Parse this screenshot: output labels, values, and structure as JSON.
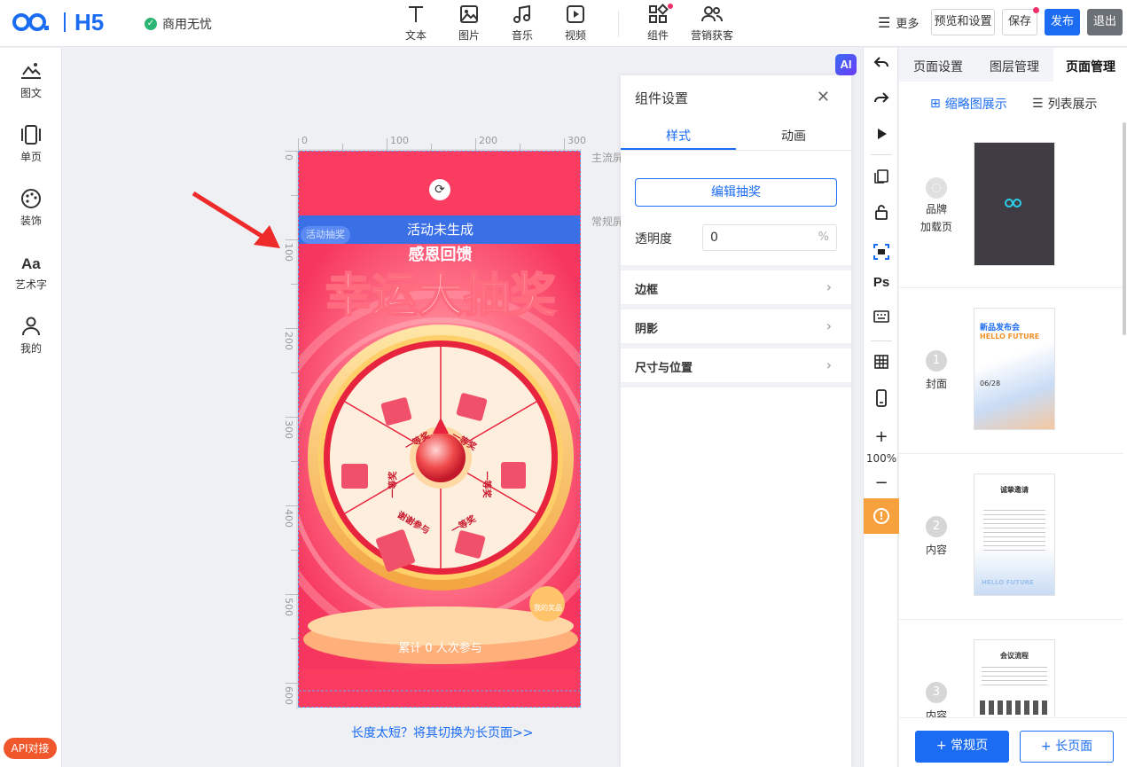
{
  "app": {
    "brand": "H5",
    "commerce_badge": "商用无忧"
  },
  "toolbar": {
    "items": [
      {
        "label": "文本",
        "icon": "text-icon"
      },
      {
        "label": "图片",
        "icon": "image-icon"
      },
      {
        "label": "音乐",
        "icon": "music-icon"
      },
      {
        "label": "视频",
        "icon": "video-icon"
      },
      {
        "label": "组件",
        "icon": "components-icon"
      },
      {
        "label": "营销获客",
        "icon": "users-icon"
      }
    ],
    "more": "更多",
    "preview": "预览和设置",
    "save": "保存",
    "publish": "发布",
    "exit": "退出"
  },
  "sidebar": {
    "items": [
      {
        "label": "图文",
        "icon": "image-text-icon"
      },
      {
        "label": "单页",
        "icon": "single-page-icon"
      },
      {
        "label": "装饰",
        "icon": "palette-icon"
      },
      {
        "label": "艺术字",
        "icon": "art-text-icon"
      },
      {
        "label": "我的",
        "icon": "user-icon"
      }
    ],
    "api_button": "API对接"
  },
  "canvas": {
    "ruler_top": [
      "0",
      "100",
      "200",
      "300"
    ],
    "ruler_left": [
      "0",
      "100",
      "200",
      "300",
      "400",
      "500",
      "600"
    ],
    "guide_main": "主流屏",
    "guide_normal": "常规屏",
    "banner_status": "活动未生成",
    "tag": "活动抽奖",
    "subtitle": "感恩回馈",
    "title": "幸运大抽奖",
    "prize_labels": [
      "一等奖",
      "一等奖",
      "一等奖",
      "谢谢参与",
      "一等奖",
      "一等奖"
    ],
    "my_prize": "我的奖品",
    "participants": "累计 0 人次参与",
    "bottom_link": "长度太短？将其切换为长页面>>"
  },
  "component_panel": {
    "title": "组件设置",
    "tabs": [
      "样式",
      "动画"
    ],
    "edit_button": "编辑抽奖",
    "opacity_label": "透明度",
    "opacity_value": "0",
    "opacity_unit": "%",
    "sections": [
      "边框",
      "阴影",
      "尺寸与位置"
    ]
  },
  "right_tools": {
    "zoom": "100%",
    "ai": "AI"
  },
  "pages_panel": {
    "tabs": [
      "页面设置",
      "图层管理",
      "页面管理"
    ],
    "view_thumb": "缩略图展示",
    "view_list": "列表展示",
    "pages": [
      {
        "num": "",
        "name": "品牌\n加载页",
        "label1": "品牌",
        "label2": "加载页"
      },
      {
        "num": "1",
        "name": "封面",
        "thumb_title": "新品发布会",
        "thumb_sub": "HELLO FUTURE",
        "thumb_date": "06/28"
      },
      {
        "num": "2",
        "name": "内容",
        "thumb_title": "诚挚邀请",
        "thumb_sub": "HELLO FUTURE"
      },
      {
        "num": "3",
        "name": "内容",
        "thumb_title": "会议流程"
      }
    ],
    "add_normal": "+ 常规页",
    "add_long": "+ 长页面"
  },
  "colors": {
    "primary": "#1b6cf2",
    "accent": "#fb3b60",
    "warn": "#f7a13e"
  }
}
